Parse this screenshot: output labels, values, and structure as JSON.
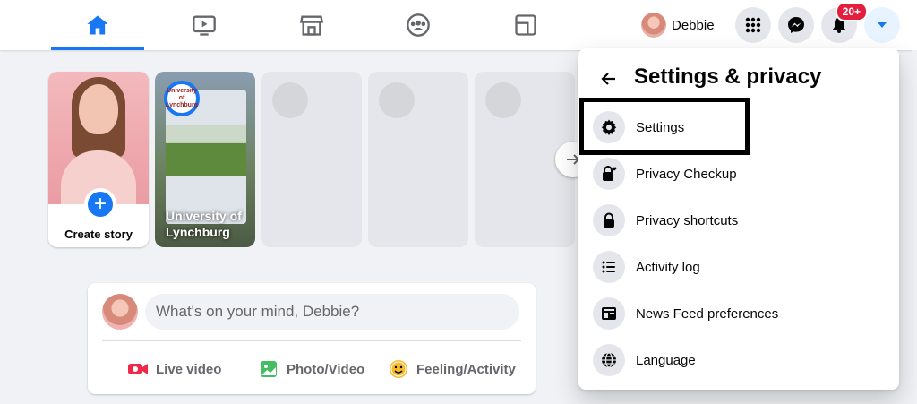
{
  "topbar": {
    "tabs": [
      {
        "name": "home",
        "active": true
      },
      {
        "name": "watch",
        "active": false
      },
      {
        "name": "marketplace",
        "active": false
      },
      {
        "name": "groups",
        "active": false
      },
      {
        "name": "gaming",
        "active": false
      }
    ],
    "profile_name": "Debbie",
    "notification_badge": "20+",
    "accent_color": "#1877f2"
  },
  "stories": {
    "create_label": "Create story",
    "uni_logo_text": "University of Lynchburg",
    "uni_title": "University of Lynchburg"
  },
  "composer": {
    "placeholder": "What's on your mind, Debbie?",
    "actions": {
      "live": "Live video",
      "photo": "Photo/Video",
      "feeling": "Feeling/Activity"
    }
  },
  "menu": {
    "title": "Settings & privacy",
    "items": [
      {
        "label": "Settings",
        "icon": "gear-icon"
      },
      {
        "label": "Privacy Checkup",
        "icon": "lock-heart-icon"
      },
      {
        "label": "Privacy shortcuts",
        "icon": "lock-icon"
      },
      {
        "label": "Activity log",
        "icon": "list-icon"
      },
      {
        "label": "News Feed preferences",
        "icon": "feed-icon"
      },
      {
        "label": "Language",
        "icon": "globe-icon"
      }
    ]
  }
}
